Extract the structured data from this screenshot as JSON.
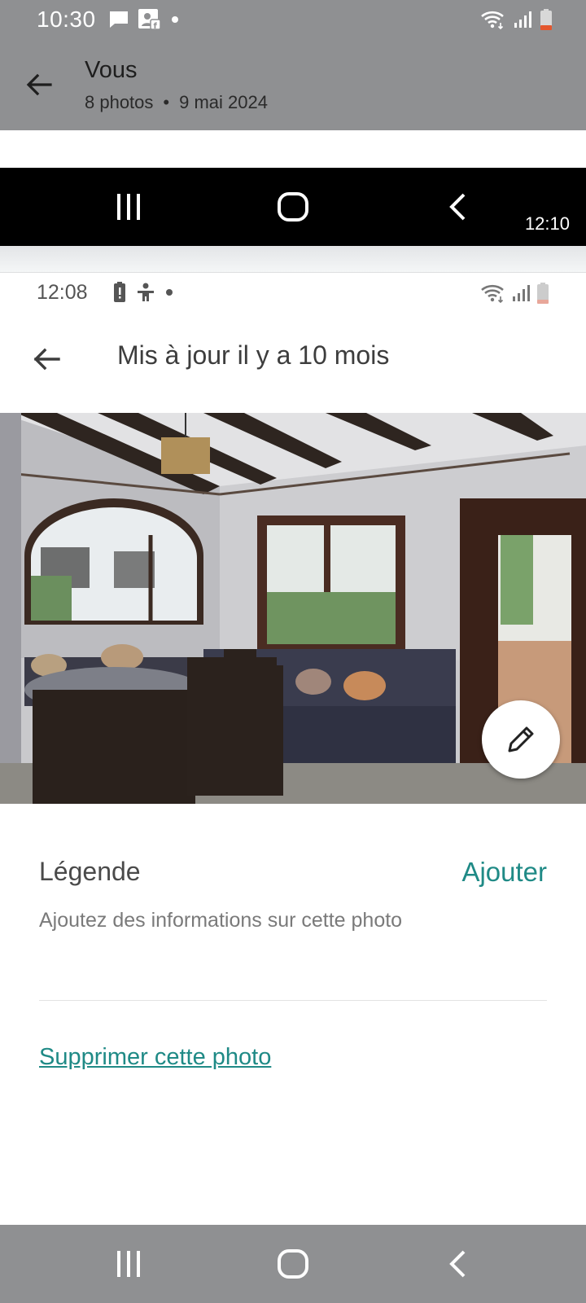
{
  "outer_status_bar": {
    "time": "10:30",
    "icons": [
      "message-icon",
      "facebook-contact-icon",
      "notification-dot-icon",
      "wifi-icon",
      "signal-icon",
      "battery-low-icon"
    ]
  },
  "outer_header": {
    "title": "Vous",
    "photo_count": "8 photos",
    "separator": "•",
    "date": "9 mai 2024"
  },
  "inner_navbar": {
    "clock": "12:10",
    "buttons": [
      "recent-apps-icon",
      "home-icon",
      "back-chevron-icon"
    ]
  },
  "inner_status_bar": {
    "time": "12:08",
    "icons": [
      "battery-alert-icon",
      "accessibility-icon",
      "notification-dot-icon",
      "wifi-icon",
      "signal-icon",
      "battery-icon"
    ]
  },
  "inner_header": {
    "title": "Mis à jour il y a 10 mois"
  },
  "caption": {
    "label": "Légende",
    "add_label": "Ajouter",
    "help_text": "Ajoutez des informations sur cette photo"
  },
  "delete_label": "Supprimer cette photo",
  "colors": {
    "accent": "#1f8a86",
    "dim_overlay": "#8f9092"
  }
}
